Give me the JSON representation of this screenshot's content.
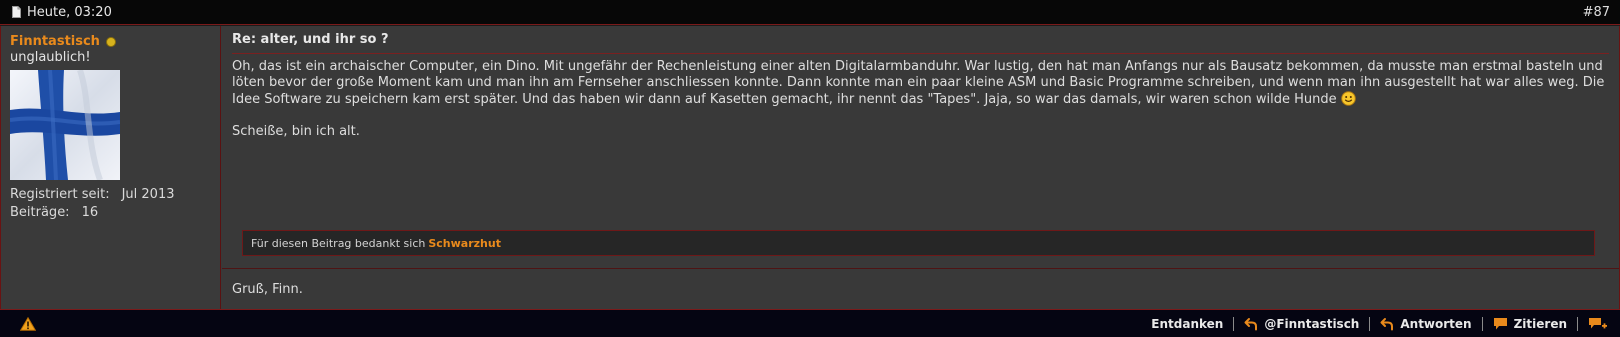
{
  "header": {
    "date": "Heute, 03:20",
    "post_number": "#87"
  },
  "user": {
    "name": "Finntastisch",
    "title": "unglaublich!",
    "registered_label": "Registriert seit:",
    "registered_value": "Jul 2013",
    "posts_label": "Beiträge:",
    "posts_value": "16",
    "status_color": "#d6b21d"
  },
  "post": {
    "title": "Re: alter, und ihr so ?",
    "paragraph1": "Oh, das ist ein archaischer Computer, ein Dino. Mit ungefähr der Rechenleistung einer alten Digitalarmbanduhr. War lustig, den hat man Anfangs nur als Bausatz bekommen, da musste man erstmal basteln und löten bevor der große Moment kam und man ihn am Fernseher anschliessen konnte. Dann konnte man ein paar kleine ASM und Basic Programme schreiben, und wenn man ihn ausgestellt hat war alles weg. Die Idee Software zu speichern kam erst später. Und das haben wir dann auf Kasetten gemacht, ihr nennt das \"Tapes\". Jaja, so war das damals, wir waren schon wilde Hunde",
    "paragraph2": "Scheiße, bin ich alt.",
    "smiley_icon": "smile-icon"
  },
  "thanks": {
    "text": "Für diesen Beitrag bedankt sich",
    "user": "Schwarzhut"
  },
  "signature": "Gruß, Finn.",
  "footer": {
    "report_icon": "warning-icon",
    "actions": [
      {
        "label": "Entdanken",
        "icon": ""
      },
      {
        "label": "@Finntastisch",
        "icon": "reply-arrow-icon"
      },
      {
        "label": "Antworten",
        "icon": "reply-arrow-icon"
      },
      {
        "label": "Zitieren",
        "icon": "quote-bubble-icon"
      },
      {
        "label": "",
        "icon": "multiquote-add-icon"
      }
    ]
  },
  "colors": {
    "accent": "#e98a1c",
    "border": "#7a1a1a",
    "background": "#393939"
  }
}
